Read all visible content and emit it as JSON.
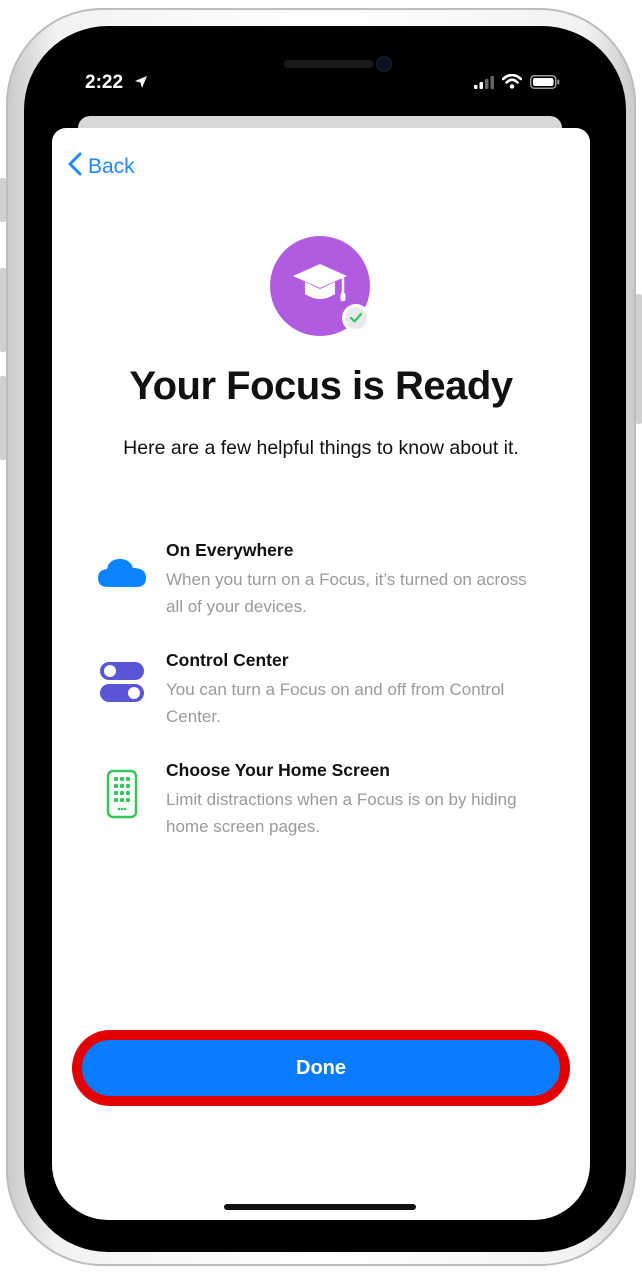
{
  "status_bar": {
    "time": "2:22"
  },
  "nav": {
    "back_label": "Back"
  },
  "header": {
    "icon": "graduation-cap-icon",
    "title": "Your Focus is Ready",
    "subtitle": "Here are a few helpful things to know about it."
  },
  "features": [
    {
      "icon": "cloud-icon",
      "title": "On Everywhere",
      "description": "When you turn on a Focus, it’s turned on across all of your devices."
    },
    {
      "icon": "toggle-switches-icon",
      "title": "Control Center",
      "description": "You can turn a Focus on and off from Control Center."
    },
    {
      "icon": "home-screen-phone-icon",
      "title": "Choose Your Home Screen",
      "description": "Limit distractions when a Focus is on by hiding home screen pages."
    }
  ],
  "done_button": {
    "label": "Done"
  },
  "colors": {
    "accent_blue": "#0a7aff",
    "focus_purple": "#b05be0",
    "highlight_red": "#e30000",
    "toggle_indigo": "#5856d6",
    "home_green": "#34c759"
  }
}
